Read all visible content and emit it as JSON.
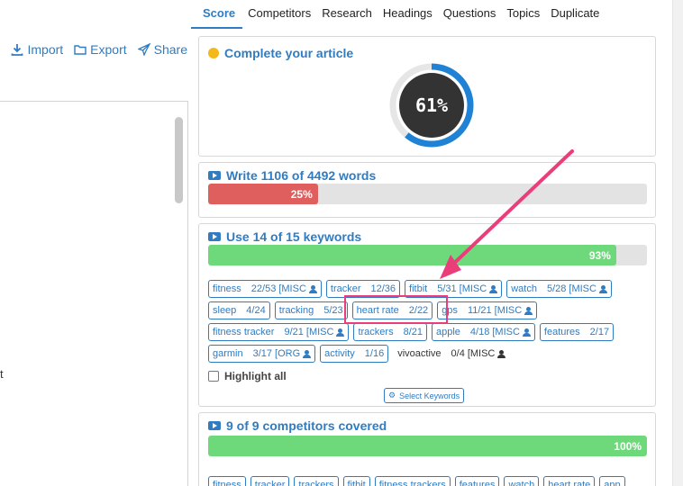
{
  "toolbar": {
    "import_label": "Import",
    "export_label": "Export",
    "share_label": "Share"
  },
  "editor": {
    "visible_text": "t"
  },
  "tabs": [
    {
      "label": "Score",
      "active": true
    },
    {
      "label": "Competitors"
    },
    {
      "label": "Research"
    },
    {
      "label": "Headings"
    },
    {
      "label": "Questions"
    },
    {
      "label": "Topics"
    },
    {
      "label": "Duplicate"
    }
  ],
  "score": {
    "title": "Complete your article",
    "percent_label": "61%",
    "progress": 0.61,
    "ring_color": "#1f82d4"
  },
  "words": {
    "title": "Write 1106 of 4492 words",
    "percent_label": "25%",
    "progress": 0.25
  },
  "keywords": {
    "title": "Use 14 of 15 keywords",
    "percent_label": "93%",
    "progress": 0.93,
    "items": [
      {
        "keyword": "fitness",
        "count": "22/53",
        "tag": "[MISC",
        "has_person": true
      },
      {
        "keyword": "tracker",
        "count": "12/36",
        "tag": "",
        "has_person": false
      },
      {
        "keyword": "fitbit",
        "count": "5/31",
        "tag": "[MISC",
        "has_person": true
      },
      {
        "keyword": "watch",
        "count": "5/28",
        "tag": "[MISC",
        "has_person": true
      },
      {
        "keyword": "sleep",
        "count": "4/24",
        "tag": "",
        "has_person": false
      },
      {
        "keyword": "tracking",
        "count": "5/23",
        "tag": "",
        "has_person": false
      },
      {
        "keyword": "heart rate",
        "count": "2/22",
        "tag": "",
        "has_person": false
      },
      {
        "keyword": "gps",
        "count": "11/21",
        "tag": "[MISC",
        "has_person": true
      },
      {
        "keyword": "fitness tracker",
        "count": "9/21",
        "tag": "[MISC",
        "has_person": true
      },
      {
        "keyword": "trackers",
        "count": "8/21",
        "tag": "",
        "has_person": false
      },
      {
        "keyword": "apple",
        "count": "4/18",
        "tag": "[MISC",
        "has_person": true
      },
      {
        "keyword": "features",
        "count": "2/17",
        "tag": "",
        "has_person": false
      },
      {
        "keyword": "garmin",
        "count": "3/17",
        "tag": "[ORG",
        "has_person": true
      },
      {
        "keyword": "activity",
        "count": "1/16",
        "tag": "",
        "has_person": false
      },
      {
        "keyword": "vivoactive",
        "count": "0/4",
        "tag": "[MISC",
        "has_person": true,
        "plain": true
      }
    ],
    "highlight_all_label": "Highlight all",
    "select_keywords_label": "Select Keywords"
  },
  "competitors": {
    "title": "9 of 9 competitors covered",
    "percent_label": "100%",
    "progress": 1.0,
    "chips": [
      "fitness",
      "tracker",
      "trackers",
      "fitbit",
      "fitness trackers",
      "features",
      "watch",
      "heart rate",
      "app"
    ]
  },
  "colors": {
    "accent": "#2f7cc2",
    "red_bar": "#df5e5e",
    "green_bar": "#6dd97a",
    "annotation": "#ea3d7a"
  }
}
